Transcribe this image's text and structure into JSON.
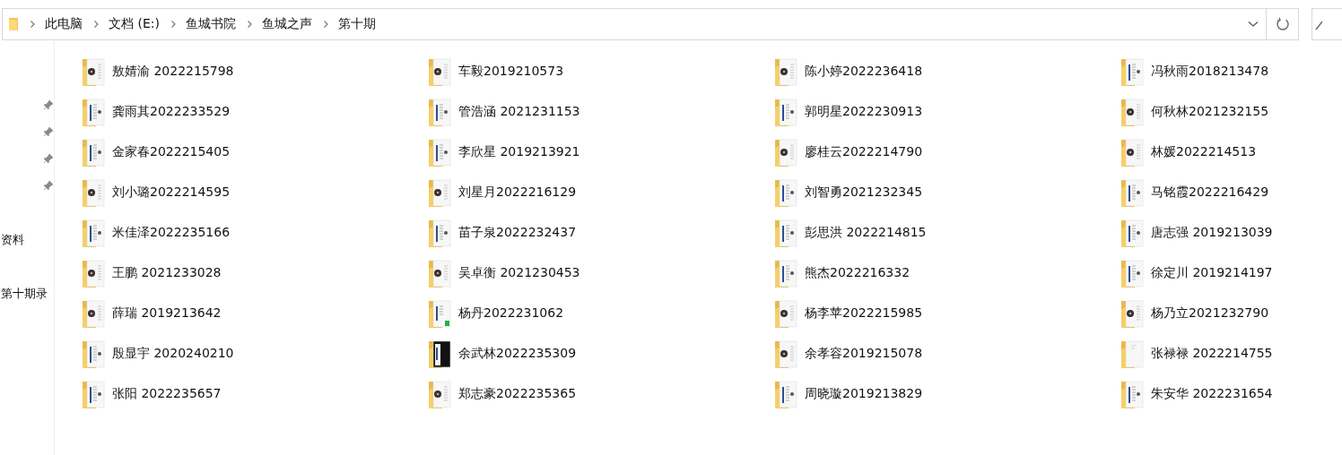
{
  "address_bar": {
    "path": [
      "此电脑",
      "文档 (E:)",
      "鱼城书院",
      "鱼城之声",
      "第十期"
    ]
  },
  "sidebar": {
    "items": [
      "资料",
      "第十期录"
    ]
  },
  "files": [
    {
      "name": "敖婧渝 2022215798",
      "kind": "disc"
    },
    {
      "name": "车毅2019210573",
      "kind": "disc"
    },
    {
      "name": "陈小婷2022236418",
      "kind": "disc"
    },
    {
      "name": "冯秋雨2018213478",
      "kind": "doc"
    },
    {
      "name": "龚雨其2022233529",
      "kind": "doc"
    },
    {
      "name": "管浩涵 2021231153",
      "kind": "doc"
    },
    {
      "name": "郭明星2022230913",
      "kind": "doc"
    },
    {
      "name": "何秋林2021232155",
      "kind": "disc"
    },
    {
      "name": "金家春2022215405",
      "kind": "doc"
    },
    {
      "name": "李欣星 2019213921",
      "kind": "doc"
    },
    {
      "name": "廖桂云2022214790",
      "kind": "disc"
    },
    {
      "name": "林媛2022214513",
      "kind": "disc"
    },
    {
      "name": "刘小璐2022214595",
      "kind": "disc"
    },
    {
      "name": "刘星月2022216129",
      "kind": "disc"
    },
    {
      "name": "刘智勇2021232345",
      "kind": "doc"
    },
    {
      "name": "马铭霞2022216429",
      "kind": "doc"
    },
    {
      "name": "米佳泽2022235166",
      "kind": "doc"
    },
    {
      "name": "苗子泉2022232437",
      "kind": "doc"
    },
    {
      "name": "彭思洪 2022214815",
      "kind": "doc"
    },
    {
      "name": "唐志强 2019213039",
      "kind": "doc"
    },
    {
      "name": "王鹏 2021233028",
      "kind": "disc"
    },
    {
      "name": "吴卓衡 2021230453",
      "kind": "disc"
    },
    {
      "name": "熊杰2022216332",
      "kind": "doc"
    },
    {
      "name": "徐定川 2019214197",
      "kind": "doc"
    },
    {
      "name": "薛瑞 2019213642",
      "kind": "disc"
    },
    {
      "name": "杨丹2022231062",
      "kind": "green"
    },
    {
      "name": "杨李苹2022215985",
      "kind": "disc"
    },
    {
      "name": "杨乃立2021232790",
      "kind": "disc"
    },
    {
      "name": "殷显宇 2020240210",
      "kind": "doc"
    },
    {
      "name": "余武林2022235309",
      "kind": "black"
    },
    {
      "name": "余孝容2019215078",
      "kind": "disc"
    },
    {
      "name": "张禄禄 2022214755",
      "kind": "blank"
    },
    {
      "name": "张阳 2022235657",
      "kind": "doc"
    },
    {
      "name": "郑志豪2022235365",
      "kind": "disc"
    },
    {
      "name": "周晓璇2019213829",
      "kind": "doc"
    },
    {
      "name": "朱安华 2022231654",
      "kind": "doc"
    }
  ]
}
